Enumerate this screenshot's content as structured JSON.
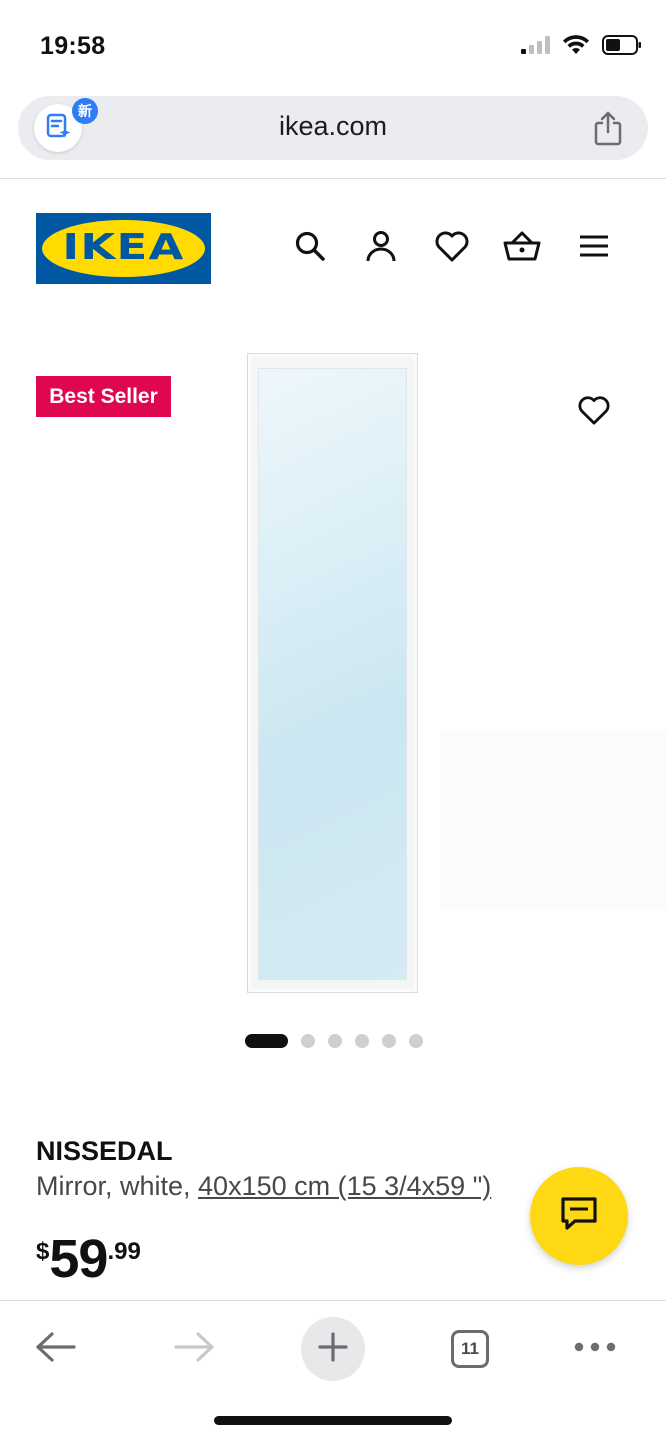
{
  "status_bar": {
    "time": "19:58",
    "icons": [
      "cellular-signal-icon",
      "wifi-icon",
      "battery-icon"
    ]
  },
  "browser": {
    "url": "ikea.com",
    "extension_badge": "新",
    "extension_icon": "document-sparkle-icon",
    "share_icon": "share-icon"
  },
  "site_header": {
    "logo_text": "IKEA",
    "icons": [
      "search-icon",
      "account-icon",
      "wishlist-heart-icon",
      "shopping-basket-icon",
      "menu-icon"
    ]
  },
  "product": {
    "badge": "Best Seller",
    "name": "NISSEDAL",
    "description_prefix": "Mirror, white, ",
    "size_link": "40x150 cm (15 3/4x59 \")",
    "price": {
      "currency": "$",
      "integer": "59",
      "decimal": ".99"
    },
    "image_count": 6,
    "active_image_index": 0
  },
  "chat": {
    "icon": "chat-bubble-icon"
  },
  "bottom_toolbar": {
    "tab_count": "11",
    "icons": [
      "back-arrow-icon",
      "forward-arrow-icon",
      "new-tab-plus-icon",
      "tabs-icon",
      "more-icon"
    ]
  },
  "colors": {
    "ikea_blue": "#0058a3",
    "ikea_yellow": "#ffdb00",
    "badge_red": "#e00751",
    "chat_yellow": "#ffd814"
  }
}
